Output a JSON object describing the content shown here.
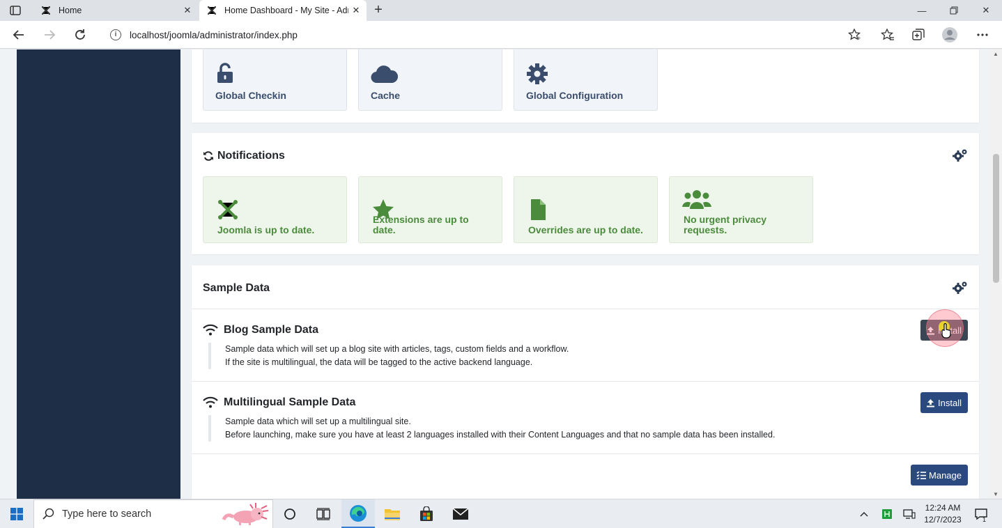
{
  "browser": {
    "tabs": [
      {
        "title": "Home",
        "active": false
      },
      {
        "title": "Home Dashboard - My Site - Administration",
        "active": true
      }
    ],
    "url": "localhost/joomla/administrator/index.php"
  },
  "quick_icons": [
    {
      "label": "Global Checkin",
      "icon": "unlock-icon"
    },
    {
      "label": "Cache",
      "icon": "cloud-icon"
    },
    {
      "label": "Global Configuration",
      "icon": "gear-icon"
    }
  ],
  "notifications": {
    "title": "Notifications",
    "items": [
      {
        "label": "Joomla is up to date.",
        "icon": "joomla-icon"
      },
      {
        "label": "Extensions are up to date.",
        "icon": "star-icon"
      },
      {
        "label": "Overrides are up to date.",
        "icon": "file-icon"
      },
      {
        "label": "No urgent privacy requests.",
        "icon": "users-icon"
      }
    ]
  },
  "sample_data": {
    "title": "Sample Data",
    "rows": [
      {
        "title": "Blog Sample Data",
        "line1": "Sample data which will set up a blog site with articles, tags, custom fields and a workflow.",
        "line2": "If the site is multilingual, the data will be tagged to the active backend language.",
        "button": "Install"
      },
      {
        "title": "Multilingual Sample Data",
        "line1": "Sample data which will set up a multilingual site.",
        "line2": "Before launching, make sure you have at least 2 languages installed with their Content Languages and that no sample data has been installed.",
        "button": "Install"
      }
    ],
    "manage_label": "Manage"
  },
  "taskbar": {
    "search_placeholder": "Type here to search",
    "time": "12:24 AM",
    "date": "12/7/2023",
    "notification_count": "1"
  },
  "colors": {
    "sidebar": "#1f2e47",
    "notification_green": "#4a8c3c",
    "button_blue": "#2a4a7f"
  }
}
